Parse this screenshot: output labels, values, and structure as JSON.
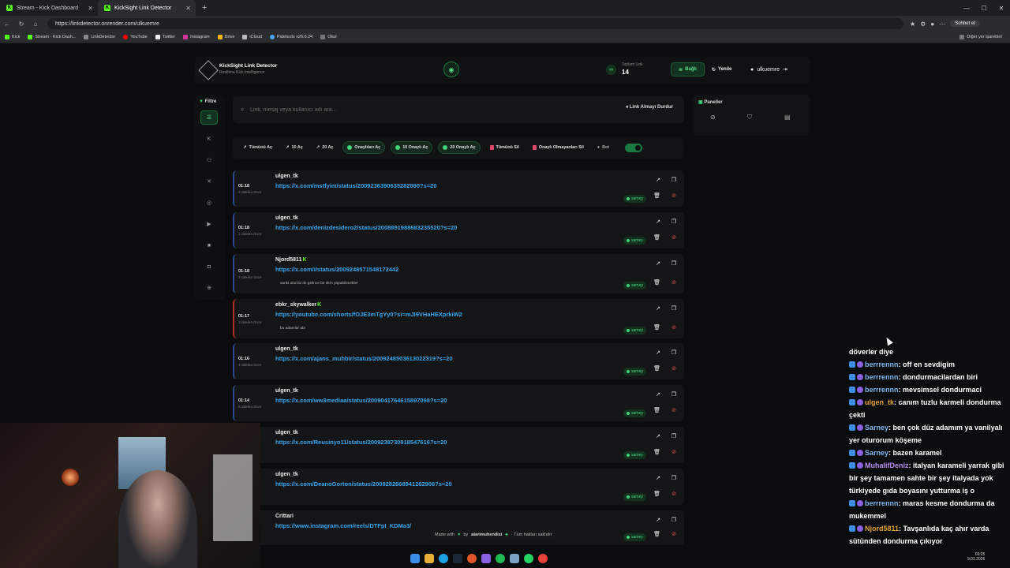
{
  "browser": {
    "tabs": [
      {
        "title": "Stream - Kick Dashboard"
      },
      {
        "title": "KickSight Link Detector"
      }
    ],
    "url": "https://linkdetector.onrender.com/ulkuemre",
    "chat_button": "Sohbet et",
    "bookmarks": [
      "Kick",
      "Stream - Kick Dash...",
      "LinkDetector",
      "YouTube",
      "Twitter",
      "Instagram",
      "Drive",
      "iCloud",
      "Paletools v26.0.24",
      "Okul"
    ],
    "bookmarks_right": "Diğer yer işaretleri"
  },
  "header": {
    "title": "KickSight Link Detector",
    "subtitle": "Realtime Kick Intelligence",
    "stat_label": "Toplam Link",
    "stat_value": "14",
    "connected_label": "Bağlı",
    "refresh_label": "Yenile",
    "username": "ulkuemre"
  },
  "rail": {
    "filter_label": "Filtre"
  },
  "search": {
    "placeholder": "Link, mesaj veya kullanıcı adı ara...",
    "stop_label": "Link Almayı Durdur"
  },
  "toolbar": {
    "open_all": "Tümünü Aç",
    "open_10": "10 Aç",
    "open_20": "20 Aç",
    "open_approved": "Onaylıları Aç",
    "open_10_approved": "10 Onaylı Aç",
    "open_20_approved": "20 Onaylı Aç",
    "delete_all": "Tümünü Sil",
    "delete_unapproved": "Onaylı Olmayanları Sil",
    "bot_label": "Bot"
  },
  "links": [
    {
      "user": "ulgen_tk",
      "time": "01:18",
      "ago": "2 dakika önce",
      "url": "https://x.com/mstfyim/status/2009236390635282890?s=20",
      "note": "",
      "tag": "sarney",
      "verified": false
    },
    {
      "user": "ulgen_tk",
      "time": "01:18",
      "ago": "2 dakika önce",
      "url": "https://x.com/denizdesidero2/status/2008891988683235520?s=20",
      "note": "",
      "tag": "sarney",
      "verified": false
    },
    {
      "user": "Njord5811",
      "time": "01:18",
      "ago": "2 dakika önce",
      "url": "https://x.com/i/status/2009248571548172442",
      "note": "sanki abd b2 ile gelince bir skm yapabilecekler",
      "tag": "sarney",
      "verified": true
    },
    {
      "user": "ebkr_skywalker",
      "time": "01:17",
      "ago": "3 dakika önce",
      "url": "https://youtube.com/shorts/fOJE3mTgYy0?si=mJI9VHaHEXprkiW2",
      "note": "bu adamlar abi",
      "tag": "sarney",
      "verified": true
    },
    {
      "user": "ulgen_tk",
      "time": "01:16",
      "ago": "4 dakika önce",
      "url": "https://x.com/ajans_muhbir/status/2009248503613022319?s=20",
      "note": "",
      "tag": "sarney",
      "verified": false
    },
    {
      "user": "ulgen_tk",
      "time": "01:14",
      "ago": "6 dakika önce",
      "url": "https://x.com/ww3mediaa/status/2009041764615897098?s=20",
      "note": "",
      "tag": "sarney",
      "verified": false
    },
    {
      "user": "ulgen_tk",
      "time": "",
      "ago": "önce",
      "url": "https://x.com/Reusinyo11/status/2009238730918547616?s=20",
      "note": "",
      "tag": "sarney",
      "verified": false
    },
    {
      "user": "ulgen_tk",
      "time": "",
      "ago": "önce",
      "url": "https://x.com/DeanoGorton/status/2009282668941262906?s=20",
      "note": "",
      "tag": "sarney",
      "verified": false
    },
    {
      "user": "Crittari",
      "time": "",
      "ago": "önce",
      "url": "https://www.instagram.com/reels/DTFpI_KDMa3/",
      "note": "",
      "tag": "sarney",
      "verified": false
    }
  ],
  "panel": {
    "title": "Paneller"
  },
  "footer": {
    "made_with": "Made with",
    "by": "by",
    "author": "atarimuhendisi",
    "rights": "· Tüm hakları saklıdır"
  },
  "chat": [
    {
      "name": "",
      "text": "döverler diye"
    },
    {
      "name": "berrrennn",
      "text": ": off en sevdigim"
    },
    {
      "name": "berrrennn",
      "text": ": dondurmacilardan biri"
    },
    {
      "name": "berrrennn",
      "text": ": mevsimsel dondurmaci"
    },
    {
      "name": "ulgen_tk",
      "text": ": canım tuzlu karmeli dondurma çekti"
    },
    {
      "name": "Sarney",
      "text": ": ben çok düz adamım ya vanilyalı yer oturorum köşeme"
    },
    {
      "name": "Sarney",
      "text": ": bazen karamel"
    },
    {
      "name": "MuhalifDeniz",
      "text": ": italyan karameli yarrak gibi bir şey tamamen sahte bir şey italyada yok türkiyede gıda boyasını yutturma iş o"
    },
    {
      "name": "berrrennn",
      "text": ": maras kesme dondurma da mukemmel"
    },
    {
      "name": "Njord5811",
      "text": ": Tavşanlıda kaç ahır varda sütünden dondurma çıkıyor"
    }
  ],
  "clock": {
    "time": "03:25",
    "date": "9.01.2026"
  }
}
